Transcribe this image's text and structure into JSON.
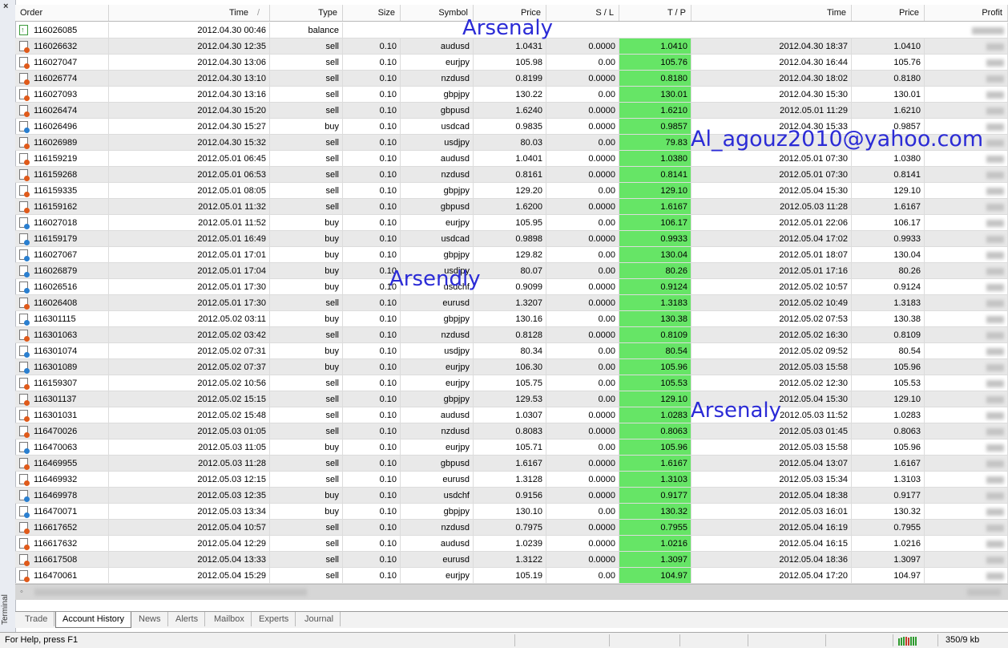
{
  "window": {
    "close_label": "×",
    "panel_name": "Terminal"
  },
  "columns": [
    "Order",
    "Time",
    "Type",
    "Size",
    "Symbol",
    "Price",
    "S / L",
    "T / P",
    "Time",
    "Price",
    "Profit"
  ],
  "sort_indicator": "/",
  "balance_row": {
    "order": "116026085",
    "time": "2012.04.30 00:46",
    "type": "balance"
  },
  "rows": [
    {
      "order": "116026632",
      "time": "2012.04.30 12:35",
      "type": "sell",
      "size": "0.10",
      "symbol": "audusd",
      "price": "1.0431",
      "sl": "0.0000",
      "tp": "1.0410",
      "ctime": "2012.04.30 18:37",
      "cprice": "1.0410"
    },
    {
      "order": "116027047",
      "time": "2012.04.30 13:06",
      "type": "sell",
      "size": "0.10",
      "symbol": "eurjpy",
      "price": "105.98",
      "sl": "0.00",
      "tp": "105.76",
      "ctime": "2012.04.30 16:44",
      "cprice": "105.76"
    },
    {
      "order": "116026774",
      "time": "2012.04.30 13:10",
      "type": "sell",
      "size": "0.10",
      "symbol": "nzdusd",
      "price": "0.8199",
      "sl": "0.0000",
      "tp": "0.8180",
      "ctime": "2012.04.30 18:02",
      "cprice": "0.8180"
    },
    {
      "order": "116027093",
      "time": "2012.04.30 13:16",
      "type": "sell",
      "size": "0.10",
      "symbol": "gbpjpy",
      "price": "130.22",
      "sl": "0.00",
      "tp": "130.01",
      "ctime": "2012.04.30 15:30",
      "cprice": "130.01"
    },
    {
      "order": "116026474",
      "time": "2012.04.30 15:20",
      "type": "sell",
      "size": "0.10",
      "symbol": "gbpusd",
      "price": "1.6240",
      "sl": "0.0000",
      "tp": "1.6210",
      "ctime": "2012.05.01 11:29",
      "cprice": "1.6210"
    },
    {
      "order": "116026496",
      "time": "2012.04.30 15:27",
      "type": "buy",
      "size": "0.10",
      "symbol": "usdcad",
      "price": "0.9835",
      "sl": "0.0000",
      "tp": "0.9857",
      "ctime": "2012.04.30 15:33",
      "cprice": "0.9857"
    },
    {
      "order": "116026989",
      "time": "2012.04.30 15:32",
      "type": "sell",
      "size": "0.10",
      "symbol": "usdjpy",
      "price": "80.03",
      "sl": "0.00",
      "tp": "79.83",
      "ctime": "",
      "cprice": ""
    },
    {
      "order": "116159219",
      "time": "2012.05.01 06:45",
      "type": "sell",
      "size": "0.10",
      "symbol": "audusd",
      "price": "1.0401",
      "sl": "0.0000",
      "tp": "1.0380",
      "ctime": "2012.05.01 07:30",
      "cprice": "1.0380"
    },
    {
      "order": "116159268",
      "time": "2012.05.01 06:53",
      "type": "sell",
      "size": "0.10",
      "symbol": "nzdusd",
      "price": "0.8161",
      "sl": "0.0000",
      "tp": "0.8141",
      "ctime": "2012.05.01 07:30",
      "cprice": "0.8141"
    },
    {
      "order": "116159335",
      "time": "2012.05.01 08:05",
      "type": "sell",
      "size": "0.10",
      "symbol": "gbpjpy",
      "price": "129.20",
      "sl": "0.00",
      "tp": "129.10",
      "ctime": "2012.05.04 15:30",
      "cprice": "129.10"
    },
    {
      "order": "116159162",
      "time": "2012.05.01 11:32",
      "type": "sell",
      "size": "0.10",
      "symbol": "gbpusd",
      "price": "1.6200",
      "sl": "0.0000",
      "tp": "1.6167",
      "ctime": "2012.05.03 11:28",
      "cprice": "1.6167"
    },
    {
      "order": "116027018",
      "time": "2012.05.01 11:52",
      "type": "buy",
      "size": "0.10",
      "symbol": "eurjpy",
      "price": "105.95",
      "sl": "0.00",
      "tp": "106.17",
      "ctime": "2012.05.01 22:06",
      "cprice": "106.17"
    },
    {
      "order": "116159179",
      "time": "2012.05.01 16:49",
      "type": "buy",
      "size": "0.10",
      "symbol": "usdcad",
      "price": "0.9898",
      "sl": "0.0000",
      "tp": "0.9933",
      "ctime": "2012.05.04 17:02",
      "cprice": "0.9933"
    },
    {
      "order": "116027067",
      "time": "2012.05.01 17:01",
      "type": "buy",
      "size": "0.10",
      "symbol": "gbpjpy",
      "price": "129.82",
      "sl": "0.00",
      "tp": "130.04",
      "ctime": "2012.05.01 18:07",
      "cprice": "130.04"
    },
    {
      "order": "116026879",
      "time": "2012.05.01 17:04",
      "type": "buy",
      "size": "0.10",
      "symbol": "usdjpy",
      "price": "80.07",
      "sl": "0.00",
      "tp": "80.26",
      "ctime": "2012.05.01 17:16",
      "cprice": "80.26"
    },
    {
      "order": "116026516",
      "time": "2012.05.01 17:30",
      "type": "buy",
      "size": "0.10",
      "symbol": "usdchf",
      "price": "0.9099",
      "sl": "0.0000",
      "tp": "0.9124",
      "ctime": "2012.05.02 10:57",
      "cprice": "0.9124"
    },
    {
      "order": "116026408",
      "time": "2012.05.01 17:30",
      "type": "sell",
      "size": "0.10",
      "symbol": "eurusd",
      "price": "1.3207",
      "sl": "0.0000",
      "tp": "1.3183",
      "ctime": "2012.05.02 10:49",
      "cprice": "1.3183"
    },
    {
      "order": "116301115",
      "time": "2012.05.02 03:11",
      "type": "buy",
      "size": "0.10",
      "symbol": "gbpjpy",
      "price": "130.16",
      "sl": "0.00",
      "tp": "130.38",
      "ctime": "2012.05.02 07:53",
      "cprice": "130.38"
    },
    {
      "order": "116301063",
      "time": "2012.05.02 03:42",
      "type": "sell",
      "size": "0.10",
      "symbol": "nzdusd",
      "price": "0.8128",
      "sl": "0.0000",
      "tp": "0.8109",
      "ctime": "2012.05.02 16:30",
      "cprice": "0.8109"
    },
    {
      "order": "116301074",
      "time": "2012.05.02 07:31",
      "type": "buy",
      "size": "0.10",
      "symbol": "usdjpy",
      "price": "80.34",
      "sl": "0.00",
      "tp": "80.54",
      "ctime": "2012.05.02 09:52",
      "cprice": "80.54"
    },
    {
      "order": "116301089",
      "time": "2012.05.02 07:37",
      "type": "buy",
      "size": "0.10",
      "symbol": "eurjpy",
      "price": "106.30",
      "sl": "0.00",
      "tp": "105.96",
      "ctime": "2012.05.03 15:58",
      "cprice": "105.96"
    },
    {
      "order": "116159307",
      "time": "2012.05.02 10:56",
      "type": "sell",
      "size": "0.10",
      "symbol": "eurjpy",
      "price": "105.75",
      "sl": "0.00",
      "tp": "105.53",
      "ctime": "2012.05.02 12:30",
      "cprice": "105.53"
    },
    {
      "order": "116301137",
      "time": "2012.05.02 15:15",
      "type": "sell",
      "size": "0.10",
      "symbol": "gbpjpy",
      "price": "129.53",
      "sl": "0.00",
      "tp": "129.10",
      "ctime": "2012.05.04 15:30",
      "cprice": "129.10"
    },
    {
      "order": "116301031",
      "time": "2012.05.02 15:48",
      "type": "sell",
      "size": "0.10",
      "symbol": "audusd",
      "price": "1.0307",
      "sl": "0.0000",
      "tp": "1.0283",
      "ctime": "2012.05.03 11:52",
      "cprice": "1.0283"
    },
    {
      "order": "116470026",
      "time": "2012.05.03 01:05",
      "type": "sell",
      "size": "0.10",
      "symbol": "nzdusd",
      "price": "0.8083",
      "sl": "0.0000",
      "tp": "0.8063",
      "ctime": "2012.05.03 01:45",
      "cprice": "0.8063"
    },
    {
      "order": "116470063",
      "time": "2012.05.03 11:05",
      "type": "buy",
      "size": "0.10",
      "symbol": "eurjpy",
      "price": "105.71",
      "sl": "0.00",
      "tp": "105.96",
      "ctime": "2012.05.03 15:58",
      "cprice": "105.96"
    },
    {
      "order": "116469955",
      "time": "2012.05.03 11:28",
      "type": "sell",
      "size": "0.10",
      "symbol": "gbpusd",
      "price": "1.6167",
      "sl": "0.0000",
      "tp": "1.6167",
      "ctime": "2012.05.04 13:07",
      "cprice": "1.6167"
    },
    {
      "order": "116469932",
      "time": "2012.05.03 12:15",
      "type": "sell",
      "size": "0.10",
      "symbol": "eurusd",
      "price": "1.3128",
      "sl": "0.0000",
      "tp": "1.3103",
      "ctime": "2012.05.03 15:34",
      "cprice": "1.3103"
    },
    {
      "order": "116469978",
      "time": "2012.05.03 12:35",
      "type": "buy",
      "size": "0.10",
      "symbol": "usdchf",
      "price": "0.9156",
      "sl": "0.0000",
      "tp": "0.9177",
      "ctime": "2012.05.04 18:38",
      "cprice": "0.9177"
    },
    {
      "order": "116470071",
      "time": "2012.05.03 13:34",
      "type": "buy",
      "size": "0.10",
      "symbol": "gbpjpy",
      "price": "130.10",
      "sl": "0.00",
      "tp": "130.32",
      "ctime": "2012.05.03 16:01",
      "cprice": "130.32"
    },
    {
      "order": "116617652",
      "time": "2012.05.04 10:57",
      "type": "sell",
      "size": "0.10",
      "symbol": "nzdusd",
      "price": "0.7975",
      "sl": "0.0000",
      "tp": "0.7955",
      "ctime": "2012.05.04 16:19",
      "cprice": "0.7955"
    },
    {
      "order": "116617632",
      "time": "2012.05.04 12:29",
      "type": "sell",
      "size": "0.10",
      "symbol": "audusd",
      "price": "1.0239",
      "sl": "0.0000",
      "tp": "1.0216",
      "ctime": "2012.05.04 16:15",
      "cprice": "1.0216"
    },
    {
      "order": "116617508",
      "time": "2012.05.04 13:33",
      "type": "sell",
      "size": "0.10",
      "symbol": "eurusd",
      "price": "1.3122",
      "sl": "0.0000",
      "tp": "1.3097",
      "ctime": "2012.05.04 18:36",
      "cprice": "1.3097"
    },
    {
      "order": "116470061",
      "time": "2012.05.04 15:29",
      "type": "sell",
      "size": "0.10",
      "symbol": "eurjpy",
      "price": "105.19",
      "sl": "0.00",
      "tp": "104.97",
      "ctime": "2012.05.04 17:20",
      "cprice": "104.97"
    }
  ],
  "tabs": [
    "Trade",
    "Account History",
    "News",
    "Alerts",
    "Mailbox",
    "Experts",
    "Journal"
  ],
  "active_tab": "Account History",
  "status": {
    "help": "For Help, press F1",
    "traffic": "350/9 kb"
  },
  "watermarks": [
    "Arsenaly",
    "Arsendly",
    "Al_agouz2010@yahoo.com",
    "Arsenaly"
  ],
  "colors": {
    "tp_highlight": "#66e566",
    "watermark": "#2b2bd6",
    "sell_dot": "#e05a1a",
    "buy_dot": "#2a7fd0"
  }
}
